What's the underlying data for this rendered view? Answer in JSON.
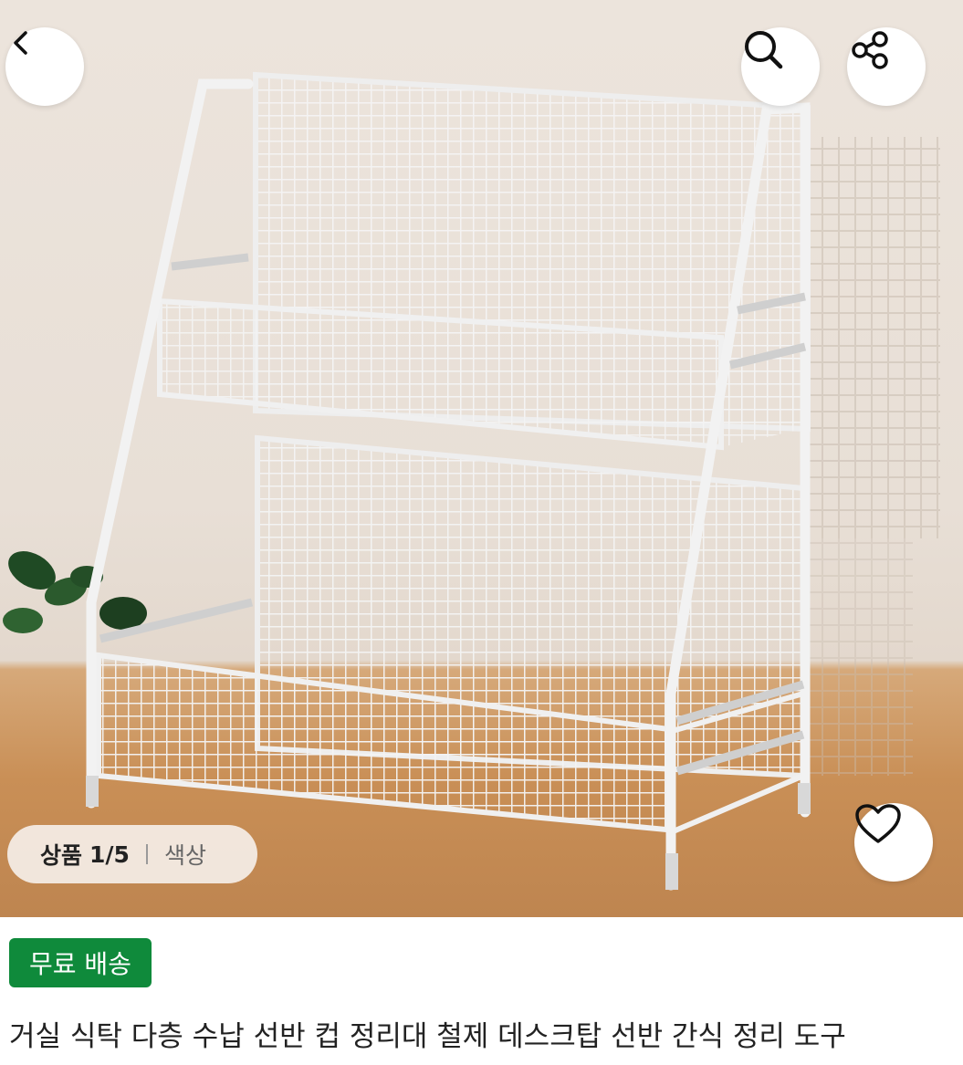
{
  "nav": {
    "back_icon": "chevron-left-icon",
    "search_icon": "search-icon",
    "share_icon": "share-icon",
    "like_icon": "heart-icon"
  },
  "image_counter": {
    "label": "상품",
    "position": "1/5",
    "option_label": "색상"
  },
  "product": {
    "badge": "무료 배송",
    "badge_color": "#0f8a3b",
    "title": "거실 식탁 다층 수납 선반 컵 정리대 철제 데스크탑 선반 간식 정리 도구"
  }
}
